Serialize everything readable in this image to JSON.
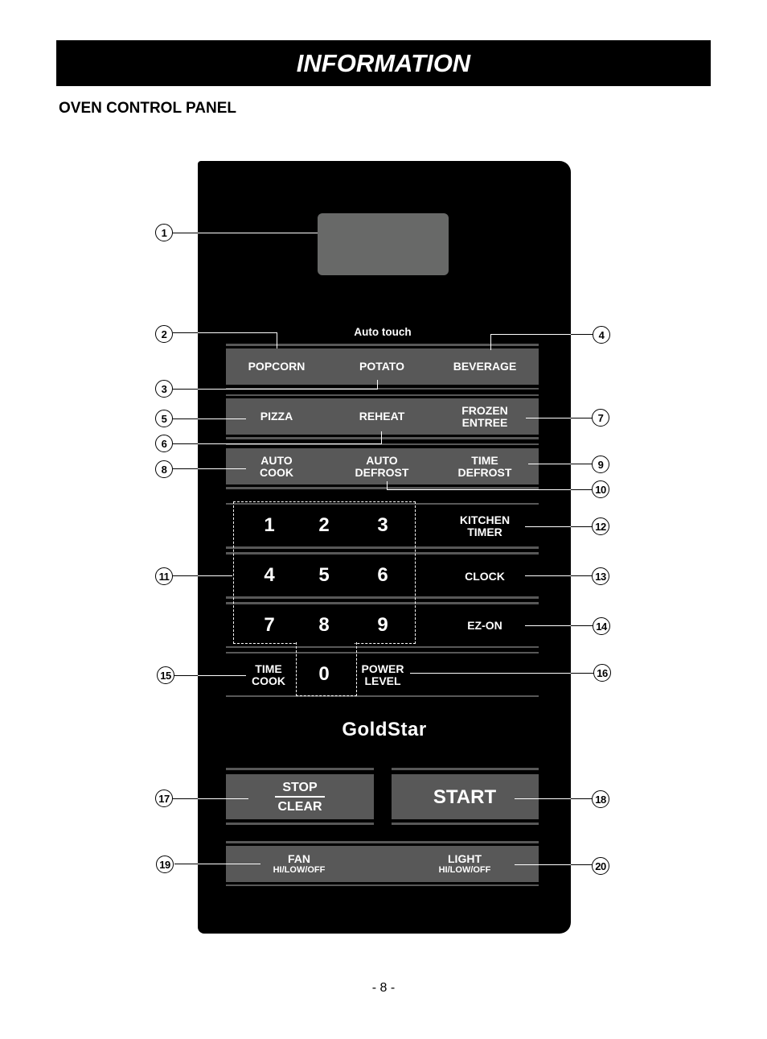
{
  "header": {
    "title": "INFORMATION"
  },
  "section": {
    "title": "OVEN CONTROL PANEL"
  },
  "panel": {
    "auto_touch_label": "Auto touch",
    "row1": {
      "popcorn": "POPCORN",
      "potato": "POTATO",
      "beverage": "BEVERAGE"
    },
    "row2": {
      "pizza": "PIZZA",
      "reheat": "REHEAT",
      "frozen_line1": "FROZEN",
      "frozen_line2": "ENTREE"
    },
    "row3": {
      "autocook_line1": "AUTO",
      "autocook_line2": "COOK",
      "autodefrost_line1": "AUTO",
      "autodefrost_line2": "DEFROST",
      "timedefrost_line1": "TIME",
      "timedefrost_line2": "DEFROST"
    },
    "keypad": {
      "digits": [
        "1",
        "2",
        "3",
        "4",
        "5",
        "6",
        "7",
        "8",
        "9",
        "0"
      ]
    },
    "side": {
      "kitchen_line1": "KITCHEN",
      "kitchen_line2": "TIMER",
      "clock": "CLOCK",
      "ezon": "EZ-ON"
    },
    "bottom": {
      "timecook_line1": "TIME",
      "timecook_line2": "COOK",
      "power_line1": "POWER",
      "power_line2": "LEVEL"
    },
    "brand": "GoldStar",
    "stop": "STOP",
    "clear": "CLEAR",
    "start": "START",
    "fan": "FAN",
    "fan_sub": "HI/LOW/OFF",
    "light": "LIGHT",
    "light_sub": "HI/LOW/OFF"
  },
  "callouts": [
    "1",
    "2",
    "3",
    "4",
    "5",
    "6",
    "7",
    "8",
    "9",
    "10",
    "11",
    "12",
    "13",
    "14",
    "15",
    "16",
    "17",
    "18",
    "19",
    "20"
  ],
  "footer": {
    "page_number": "- 8 -"
  }
}
